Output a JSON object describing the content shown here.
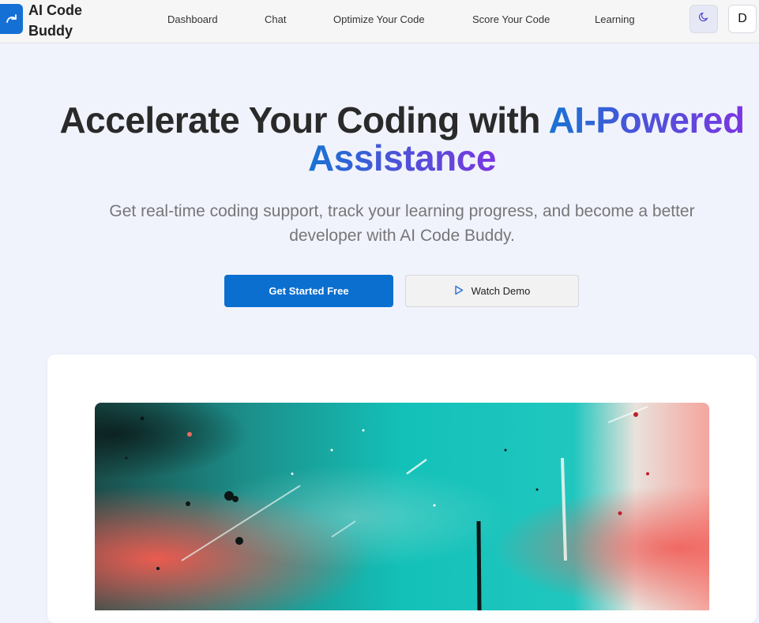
{
  "brand": {
    "name": "AI Code Buddy",
    "logo_icon": "redo-arrow-icon",
    "accent": "#1570d6"
  },
  "nav": {
    "links": [
      {
        "label": "Dashboard"
      },
      {
        "label": "Chat"
      },
      {
        "label": "Optimize Your Code"
      },
      {
        "label": "Score Your Code"
      },
      {
        "label": "Learning"
      }
    ],
    "theme_toggle_icon": "moon-icon",
    "avatar_initial": "D"
  },
  "hero": {
    "title_plain": "Accelerate Your Coding with ",
    "title_highlight_1": "AI-Powered",
    "title_highlight_2": "Assistance",
    "subtitle": "Get real-time coding support, track your learning progress, and become a better developer with AI Code Buddy.",
    "primary_cta": "Get Started Free",
    "secondary_cta": "Watch Demo",
    "secondary_cta_icon": "play-icon",
    "gradient": [
      "#1874d2",
      "#4a55d8",
      "#7a36e0"
    ]
  },
  "preview": {
    "image_icon": "abstract-painting-image",
    "colors": [
      "#16c6bd",
      "#f06a5c",
      "#0b2a2a"
    ]
  }
}
